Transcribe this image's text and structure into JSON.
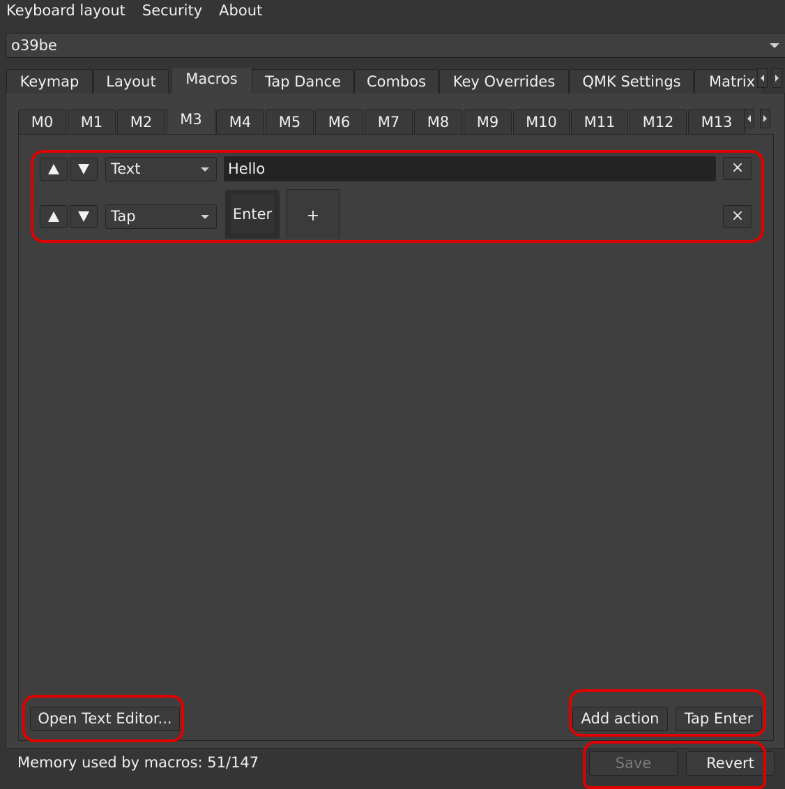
{
  "menubar": {
    "items": [
      "Keyboard layout",
      "Security",
      "About"
    ]
  },
  "keyboard_select": {
    "value": "o39be"
  },
  "main_tabs": [
    "Keymap",
    "Layout",
    "Macros",
    "Tap Dance",
    "Combos",
    "Key Overrides",
    "QMK Settings",
    "Matrix"
  ],
  "main_tabs_active": "Macros",
  "macro_tabs": [
    "M0",
    "M1",
    "M2",
    "M3",
    "M4",
    "M5",
    "M6",
    "M7",
    "M8",
    "M9",
    "M10",
    "M11",
    "M12",
    "M13"
  ],
  "macro_tabs_active": "M3",
  "actions": [
    {
      "type": "Text",
      "value": "Hello",
      "delete": "×"
    },
    {
      "type": "Tap",
      "keys": [
        "Enter"
      ],
      "add_key": "+",
      "delete": "×"
    }
  ],
  "buttons": {
    "open_text_editor": "Open Text Editor...",
    "add_action": "Add action",
    "tap_enter": "Tap Enter",
    "save": "Save",
    "revert": "Revert"
  },
  "status": {
    "memory": "Memory used by macros: 51/147"
  },
  "colors": {
    "background": "#353535",
    "panel": "#404040",
    "highlight": "#e00000"
  }
}
